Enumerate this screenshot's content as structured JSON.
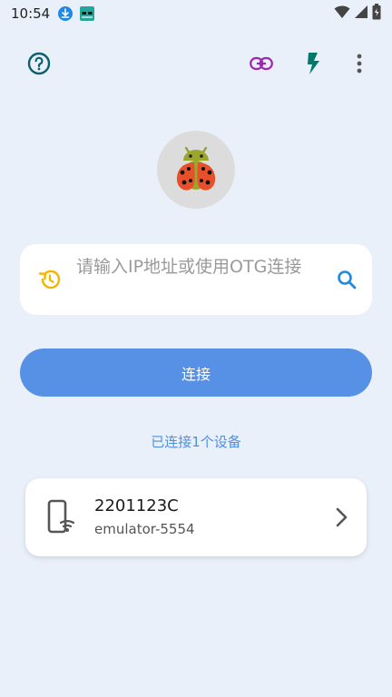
{
  "status_bar": {
    "time": "10:54",
    "icons": [
      "download-icon",
      "app-notification-icon",
      "wifi-icon",
      "signal-icon",
      "battery-icon"
    ]
  },
  "toolbar": {
    "icons": [
      "help-icon",
      "link-icon",
      "flash-icon",
      "more-vert-icon"
    ]
  },
  "search": {
    "placeholder": "请输入IP地址或使用OTG连接",
    "value": ""
  },
  "connect_button": {
    "label": "连接"
  },
  "connected_devices": {
    "label": "已连接1个设备"
  },
  "devices": [
    {
      "name": "2201123C",
      "serial": "emulator-5554"
    }
  ],
  "colors": {
    "background": "#eaf0f9",
    "accent": "#5791e6",
    "link_purple": "#9c27b0",
    "flash_teal": "#00796b",
    "help_teal": "#0a5f6f",
    "search_blue": "#1e88e5",
    "history_amber": "#f4b400"
  }
}
